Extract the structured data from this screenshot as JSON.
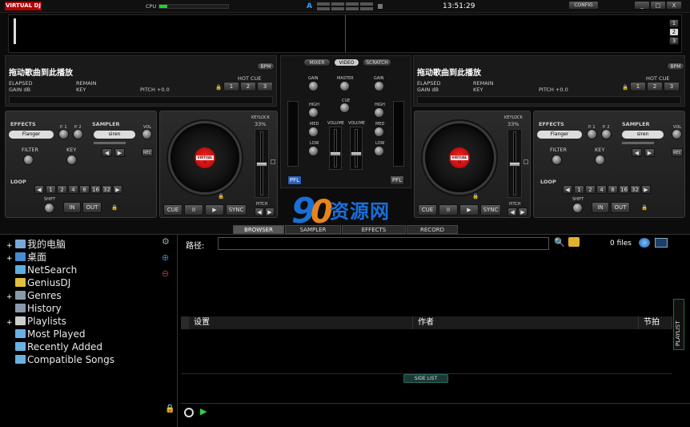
{
  "app": {
    "logo": "VIRTUAL DJ",
    "cpu_label": "CPU",
    "cpu_level": 0.12,
    "clock": "13:51:29",
    "config_label": "CONFIG",
    "layout_indicator": "A"
  },
  "window_controls": [
    "_",
    "□",
    "X"
  ],
  "wave_select": [
    "1",
    "2",
    "3"
  ],
  "deck_left": {
    "title": "拖动歌曲到此播放",
    "elapsed": "ELAPSED",
    "remain": "REMAIN",
    "gain": "GAIN dB",
    "key": "KEY",
    "pitch": "PITCH +0.0",
    "bpm": "BPM",
    "hot_cue_label": "HOT CUE",
    "hot_cues": [
      "1",
      "2",
      "3"
    ],
    "effects_label": "EFFECTS",
    "effect_value": "Flanger",
    "p1": "P. 1",
    "p2": "P. 2",
    "sampler_label": "SAMPLER",
    "sampler_value": "siren",
    "vol": "VOL",
    "rec": "REC",
    "filter": "FILTER",
    "key_knob": "KEY",
    "loop_label": "LOOP",
    "loop_values": [
      "1",
      "2",
      "4",
      "8",
      "16",
      "32"
    ],
    "shift": "SHIFT",
    "in": "IN",
    "out": "OUT",
    "keylock": "KEYLOCK",
    "pitch_pct": "33%",
    "pitch_label": "PITCH",
    "transport": [
      "CUE",
      "II",
      "▶",
      "SYNC"
    ],
    "pfl": "PFL"
  },
  "deck_right": {
    "title": "拖动歌曲到此播放",
    "elapsed": "ELAPSED",
    "remain": "REMAIN",
    "gain": "GAIN dB",
    "key": "KEY",
    "pitch": "PITCH +0.0",
    "bpm": "BPM",
    "hot_cue_label": "HOT CUE",
    "hot_cues": [
      "1",
      "2",
      "3"
    ],
    "effects_label": "EFFECTS",
    "effect_value": "Flanger",
    "p1": "P. 1",
    "p2": "P. 2",
    "sampler_label": "SAMPLER",
    "sampler_value": "siren",
    "vol": "VOL",
    "rec": "REC",
    "filter": "FILTER",
    "key_knob": "KEY",
    "loop_label": "LOOP",
    "loop_values": [
      "1",
      "2",
      "4",
      "8",
      "16",
      "32"
    ],
    "shift": "SHIFT",
    "in": "IN",
    "out": "OUT",
    "keylock": "KEYLOCK",
    "pitch_pct": "33%",
    "pitch_label": "PITCH",
    "transport": [
      "CUE",
      "II",
      "▶",
      "SYNC"
    ],
    "pfl": "PFL"
  },
  "mixer": {
    "tabs": [
      "MIXER",
      "VIDEO",
      "SCRATCH"
    ],
    "gain": "GAIN",
    "master": "MASTER",
    "cue": "CUE",
    "high": "HIGH",
    "med": "MED",
    "low": "LOW",
    "volume": "VOLUME"
  },
  "browser_tabs": [
    "BROWSER",
    "SAMPLER",
    "EFFECTS",
    "RECORD"
  ],
  "tree": [
    {
      "label": "我的电脑",
      "expand": "+",
      "icon": "computer-icon",
      "color": "#7aa7d8"
    },
    {
      "label": "桌面",
      "expand": "+",
      "icon": "desktop-icon",
      "color": "#4a8ad0"
    },
    {
      "label": "NetSearch",
      "expand": "",
      "icon": "netsearch-icon",
      "color": "#5ab0e0"
    },
    {
      "label": "GeniusDJ",
      "expand": "",
      "icon": "geniusdj-icon",
      "color": "#e0c040"
    },
    {
      "label": "Genres",
      "expand": "+",
      "icon": "genres-icon",
      "color": "#8899aa"
    },
    {
      "label": "History",
      "expand": "",
      "icon": "history-icon",
      "color": "#8899aa"
    },
    {
      "label": "Playlists",
      "expand": "+",
      "icon": "playlists-icon",
      "color": "#cccccc"
    },
    {
      "label": "Most Played",
      "expand": "",
      "icon": "folder-icon",
      "color": "#6ab0e0"
    },
    {
      "label": "Recently Added",
      "expand": "",
      "icon": "folder-icon",
      "color": "#6ab0e0"
    },
    {
      "label": "Compatible Songs",
      "expand": "",
      "icon": "folder-icon",
      "color": "#6ab0e0"
    }
  ],
  "path": {
    "label": "路径:",
    "value": ""
  },
  "files_count": "0 files",
  "columns": [
    "设置",
    "作者",
    "节拍"
  ],
  "side_list": "SIDE LIST",
  "playlist": "PLAYLIST",
  "watermark": "资源网"
}
